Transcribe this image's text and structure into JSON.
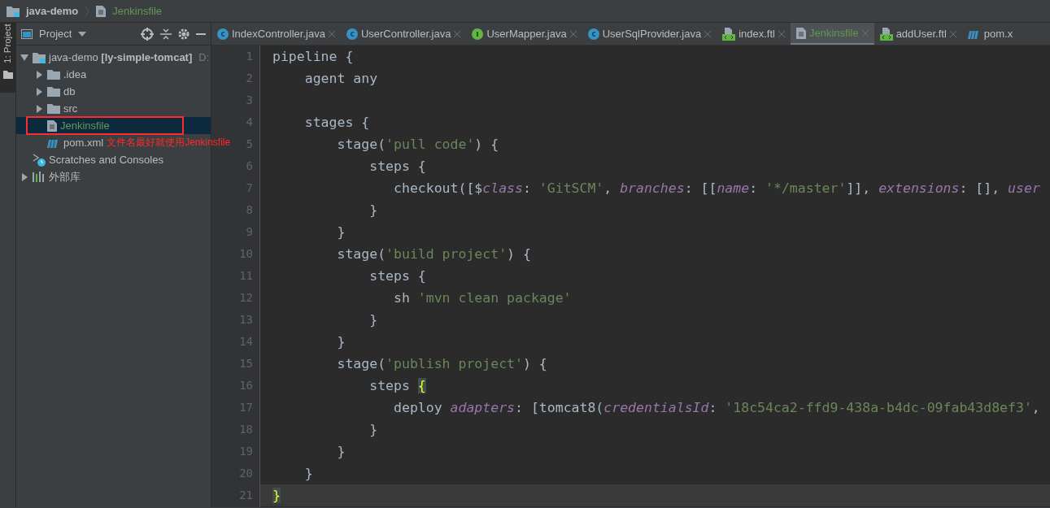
{
  "breadcrumb": [
    {
      "label": "java-demo",
      "kind": "module"
    },
    {
      "label": "Jenkinsfile",
      "kind": "file"
    }
  ],
  "side_strip": {
    "label": "1: Project"
  },
  "project_panel": {
    "title": "Project",
    "tree": [
      {
        "label": "java-demo **[ly-simple-tomcat]**",
        "path_hint": "D:",
        "kind": "module",
        "expanded": true,
        "selected": false,
        "children": [
          {
            "label": ".idea",
            "kind": "folder",
            "expanded": false,
            "selected": false
          },
          {
            "label": "db",
            "kind": "folder",
            "expanded": false,
            "selected": false
          },
          {
            "label": "src",
            "kind": "folder",
            "expanded": false,
            "selected": false
          },
          {
            "label": "Jenkinsfile",
            "kind": "file",
            "selected": true
          },
          {
            "label": "pom.xml",
            "kind": "maven",
            "selected": false
          }
        ]
      },
      {
        "label": "Scratches and Consoles",
        "kind": "scratches",
        "selected": false
      },
      {
        "label": "外部库",
        "kind": "library",
        "expanded": false,
        "selected": false
      }
    ]
  },
  "annotation": {
    "text": "文件名最好就使用Jenkinsfile"
  },
  "tabs": [
    {
      "label": "IndexController.java",
      "kind": "class",
      "selected": false
    },
    {
      "label": "UserController.java",
      "kind": "class",
      "selected": false
    },
    {
      "label": "UserMapper.java",
      "kind": "interface",
      "selected": false
    },
    {
      "label": "UserSqlProvider.java",
      "kind": "class",
      "selected": false
    },
    {
      "label": "index.ftl",
      "kind": "ftl",
      "selected": false
    },
    {
      "label": "Jenkinsfile",
      "kind": "file",
      "selected": true
    },
    {
      "label": "addUser.ftl",
      "kind": "ftl",
      "selected": false
    },
    {
      "label": "pom.x",
      "kind": "maven",
      "selected": false
    }
  ],
  "editor": {
    "lines": [
      {
        "number": "1",
        "current": false,
        "tokens": [
          {
            "kind": "plain",
            "text": "pipeline {"
          }
        ]
      },
      {
        "number": "2",
        "current": false,
        "tokens": [
          {
            "kind": "plain",
            "text": "    agent any"
          }
        ]
      },
      {
        "number": "3",
        "current": false
      },
      {
        "number": "4",
        "current": false,
        "tokens": [
          {
            "kind": "plain",
            "text": "    stages {"
          }
        ]
      },
      {
        "number": "5",
        "current": false,
        "tokens": [
          {
            "kind": "plain",
            "text": "        stage("
          },
          {
            "kind": "string",
            "text": "'pull code'"
          },
          {
            "kind": "plain",
            "text": ") {"
          }
        ]
      },
      {
        "number": "6",
        "current": false,
        "tokens": [
          {
            "kind": "plain",
            "text": "            steps {"
          }
        ]
      },
      {
        "number": "7",
        "current": false,
        "tokens": [
          {
            "kind": "plain",
            "text": "               checkout([$"
          },
          {
            "kind": "param",
            "text": "class"
          },
          {
            "kind": "plain",
            "text": ": "
          },
          {
            "kind": "string",
            "text": "'GitSCM'"
          },
          {
            "kind": "plain",
            "text": ", "
          },
          {
            "kind": "param",
            "text": "branches"
          },
          {
            "kind": "plain",
            "text": ": [["
          },
          {
            "kind": "param",
            "text": "name"
          },
          {
            "kind": "plain",
            "text": ": "
          },
          {
            "kind": "string",
            "text": "'*/master'"
          },
          {
            "kind": "plain",
            "text": "]], "
          },
          {
            "kind": "param",
            "text": "extensions"
          },
          {
            "kind": "plain",
            "text": ": [], "
          },
          {
            "kind": "param",
            "text": "user"
          }
        ]
      },
      {
        "number": "8",
        "current": false,
        "tokens": [
          {
            "kind": "plain",
            "text": "            }"
          }
        ]
      },
      {
        "number": "9",
        "current": false,
        "tokens": [
          {
            "kind": "plain",
            "text": "        }"
          }
        ]
      },
      {
        "number": "10",
        "current": false,
        "tokens": [
          {
            "kind": "plain",
            "text": "        stage("
          },
          {
            "kind": "string",
            "text": "'build project'"
          },
          {
            "kind": "plain",
            "text": ") {"
          }
        ]
      },
      {
        "number": "11",
        "current": false,
        "tokens": [
          {
            "kind": "plain",
            "text": "            steps {"
          }
        ]
      },
      {
        "number": "12",
        "current": false,
        "tokens": [
          {
            "kind": "plain",
            "text": "               sh "
          },
          {
            "kind": "string",
            "text": "'mvn clean package'"
          }
        ]
      },
      {
        "number": "13",
        "current": false,
        "tokens": [
          {
            "kind": "plain",
            "text": "            }"
          }
        ]
      },
      {
        "number": "14",
        "current": false,
        "tokens": [
          {
            "kind": "plain",
            "text": "        }"
          }
        ]
      },
      {
        "number": "15",
        "current": false,
        "tokens": [
          {
            "kind": "plain",
            "text": "        stage("
          },
          {
            "kind": "string",
            "text": "'publish project'"
          },
          {
            "kind": "plain",
            "text": ") {"
          }
        ]
      },
      {
        "number": "16",
        "current": false,
        "tokens": [
          {
            "kind": "plain",
            "text": "            steps "
          },
          {
            "kind": "brace",
            "text": "{"
          }
        ]
      },
      {
        "number": "17",
        "current": false,
        "tokens": [
          {
            "kind": "plain",
            "text": "               deploy "
          },
          {
            "kind": "param",
            "text": "adapters"
          },
          {
            "kind": "plain",
            "text": ": [tomcat8("
          },
          {
            "kind": "param",
            "text": "credentialsId"
          },
          {
            "kind": "plain",
            "text": ": "
          },
          {
            "kind": "string",
            "text": "'18c54ca2-ffd9-438a-b4dc-09fab43d8ef3'"
          },
          {
            "kind": "plain",
            "text": ","
          }
        ]
      },
      {
        "number": "18",
        "current": false,
        "tokens": [
          {
            "kind": "plain",
            "text": "            }"
          }
        ]
      },
      {
        "number": "19",
        "current": false,
        "tokens": [
          {
            "kind": "plain",
            "text": "        }"
          }
        ]
      },
      {
        "number": "20",
        "current": false,
        "tokens": [
          {
            "kind": "plain",
            "text": "    }"
          }
        ]
      },
      {
        "number": "21",
        "current": true,
        "tokens": [
          {
            "kind": "brace",
            "text": "}"
          }
        ]
      }
    ]
  }
}
